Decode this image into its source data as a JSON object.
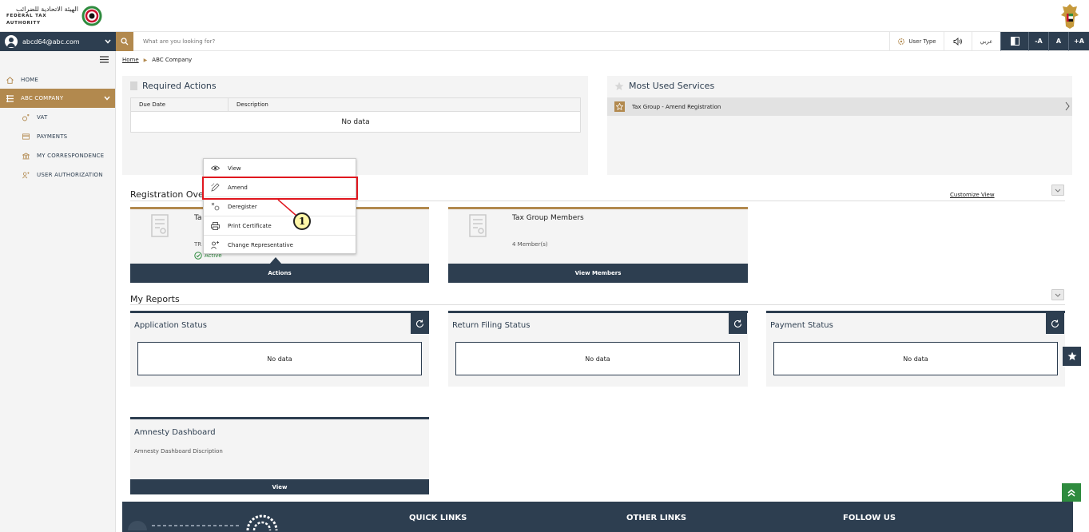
{
  "header": {
    "logo_arabic": "الهيئة الاتحادية للضرائب",
    "logo_english": "FEDERAL TAX AUTHORITY"
  },
  "topbar": {
    "user_email": "abcd64@abc.com",
    "search_placeholder": "What are you looking for?",
    "user_type_label": "User Type",
    "arabic_label": "عربي",
    "font_decrease": "-A",
    "font_normal": "A",
    "font_increase": "+A"
  },
  "sidebar": {
    "items": [
      {
        "label": "HOME",
        "icon": "home-icon"
      },
      {
        "label": "ABC COMPANY",
        "icon": "grid-icon"
      },
      {
        "label": "VAT",
        "icon": "vat-icon"
      },
      {
        "label": "PAYMENTS",
        "icon": "payments-icon"
      },
      {
        "label": "MY CORRESPONDENCE",
        "icon": "bank-icon"
      },
      {
        "label": "USER AUTHORIZATION",
        "icon": "user-key-icon"
      }
    ]
  },
  "breadcrumb": {
    "home": "Home",
    "current": "ABC Company"
  },
  "required_actions": {
    "title": "Required Actions",
    "columns": [
      "Due Date",
      "Description"
    ],
    "empty": "No data"
  },
  "most_used": {
    "title": "Most Used Services",
    "items": [
      "Tax Group - Amend Registration"
    ]
  },
  "registration": {
    "title": "Registration Overview",
    "customize": "Customize View",
    "card1": {
      "title_partial": "Ta",
      "trn_partial": "TR",
      "status": "Active",
      "button": "Actions"
    },
    "card2": {
      "title": "Tax Group Members",
      "members": "4 Member(s)",
      "button": "View Members"
    }
  },
  "popup": {
    "items": [
      {
        "label": "View",
        "icon": "eye-icon"
      },
      {
        "label": "Amend",
        "icon": "pencil-icon"
      },
      {
        "label": "Deregister",
        "icon": "deregister-icon"
      },
      {
        "label": "Print Certificate",
        "icon": "printer-icon"
      },
      {
        "label": "Change Representative",
        "icon": "change-user-icon"
      }
    ],
    "callout": "1"
  },
  "reports": {
    "title": "My Reports",
    "cards": [
      {
        "title": "Application Status",
        "empty": "No data"
      },
      {
        "title": "Return Filing Status",
        "empty": "No data"
      },
      {
        "title": "Payment Status",
        "empty": "No data"
      }
    ]
  },
  "amnesty": {
    "title": "Amnesty Dashboard",
    "description": "Amnesty Dashboard Discription",
    "button": "View"
  },
  "footer": {
    "quick_links": "QUICK LINKS",
    "other_links": "OTHER LINKS",
    "follow_us": "FOLLOW US"
  },
  "colors": {
    "navy": "#2d3e50",
    "gold": "#b2894e",
    "highlight": "#e0161e",
    "green": "#2e8b3e"
  }
}
